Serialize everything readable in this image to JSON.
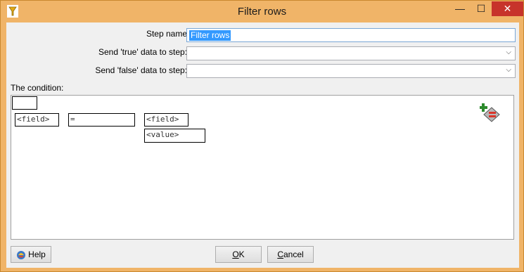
{
  "window": {
    "title": "Filter rows",
    "min_glyph": "—",
    "max_glyph": "☐",
    "close_glyph": "✕"
  },
  "form": {
    "step_name_label": "Step name",
    "step_name_value": "Filter rows",
    "true_label": "Send 'true' data to step:",
    "true_value": "",
    "false_label": "Send 'false' data to step:",
    "false_value": "",
    "condition_label": "The condition:"
  },
  "condition": {
    "left_field": "<field>",
    "operator": "=",
    "right_field": "<field>",
    "right_value": "<value>"
  },
  "buttons": {
    "help": "Help",
    "ok_u": "O",
    "ok_rest": "K",
    "cancel_u": "C",
    "cancel_rest": "ancel"
  },
  "colors": {
    "title_bar": "#f0b468",
    "close_button": "#c7332b",
    "selection": "#3399ff"
  },
  "icons": [
    "app-icon",
    "minimize-icon",
    "maximize-icon",
    "close-icon",
    "add-condition-icon",
    "help-icon",
    "dropdown-arrow-icon"
  ]
}
